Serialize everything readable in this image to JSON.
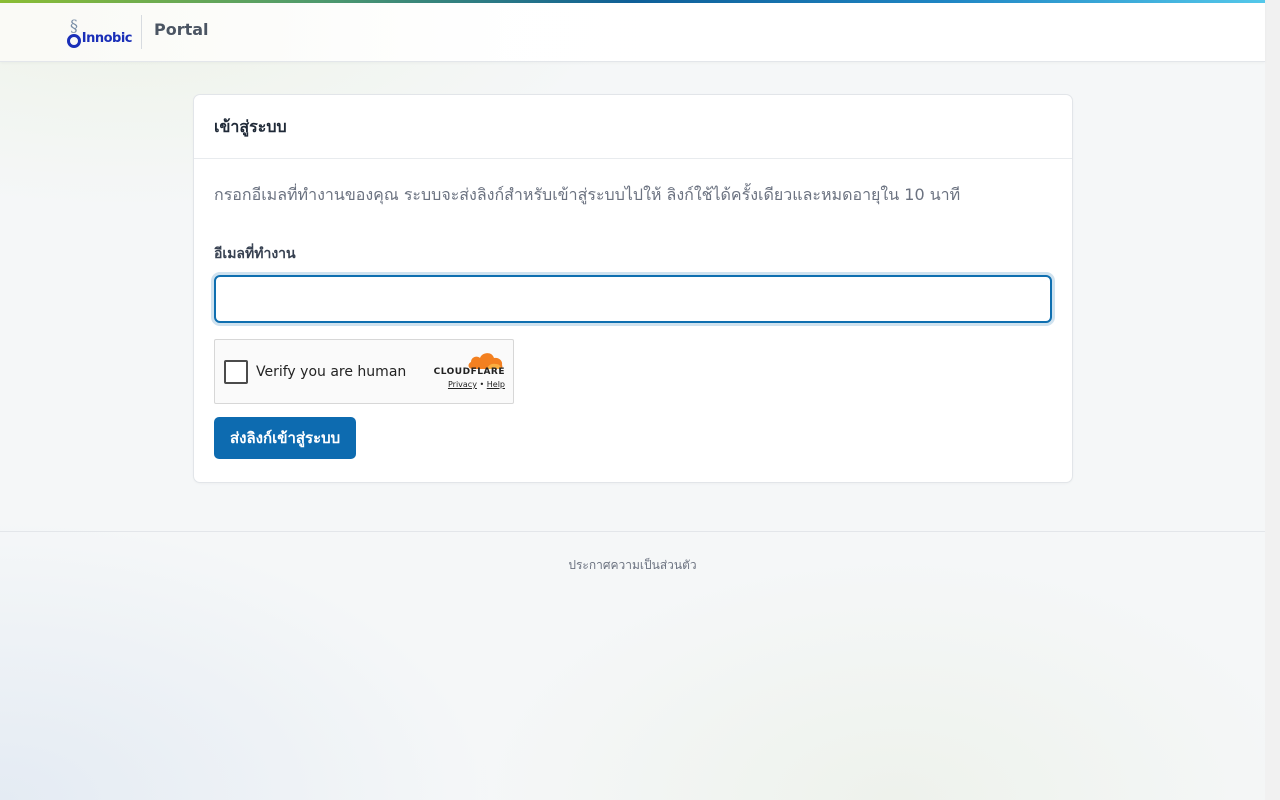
{
  "header": {
    "logo_text": "Innobic",
    "portal_title": "Portal",
    "accent_colors": [
      "#8bbd34",
      "#0e5f98",
      "#54c8ea"
    ]
  },
  "login": {
    "title": "เข้าสู่ระบบ",
    "intro": "กรอกอีเมลที่ทำงานของคุณ ระบบจะส่งลิงก์สำหรับเข้าสู่ระบบไปให้ ลิงก์ใช้ได้ครั้งเดียวและหมดอายุใน 10 นาที",
    "email_label": "อีเมลที่ทำงาน",
    "email_value": "",
    "submit_label": "ส่งลิงก์เข้าสู่ระบบ",
    "submit_color": "#0d6bb0"
  },
  "captcha": {
    "label": "Verify you are human",
    "brand": "CLOUDFLARE",
    "privacy": "Privacy",
    "separator": "•",
    "help": "Help",
    "brand_color": "#f38020"
  },
  "footer": {
    "privacy_link": "ประกาศความเป็นส่วนตัว"
  }
}
